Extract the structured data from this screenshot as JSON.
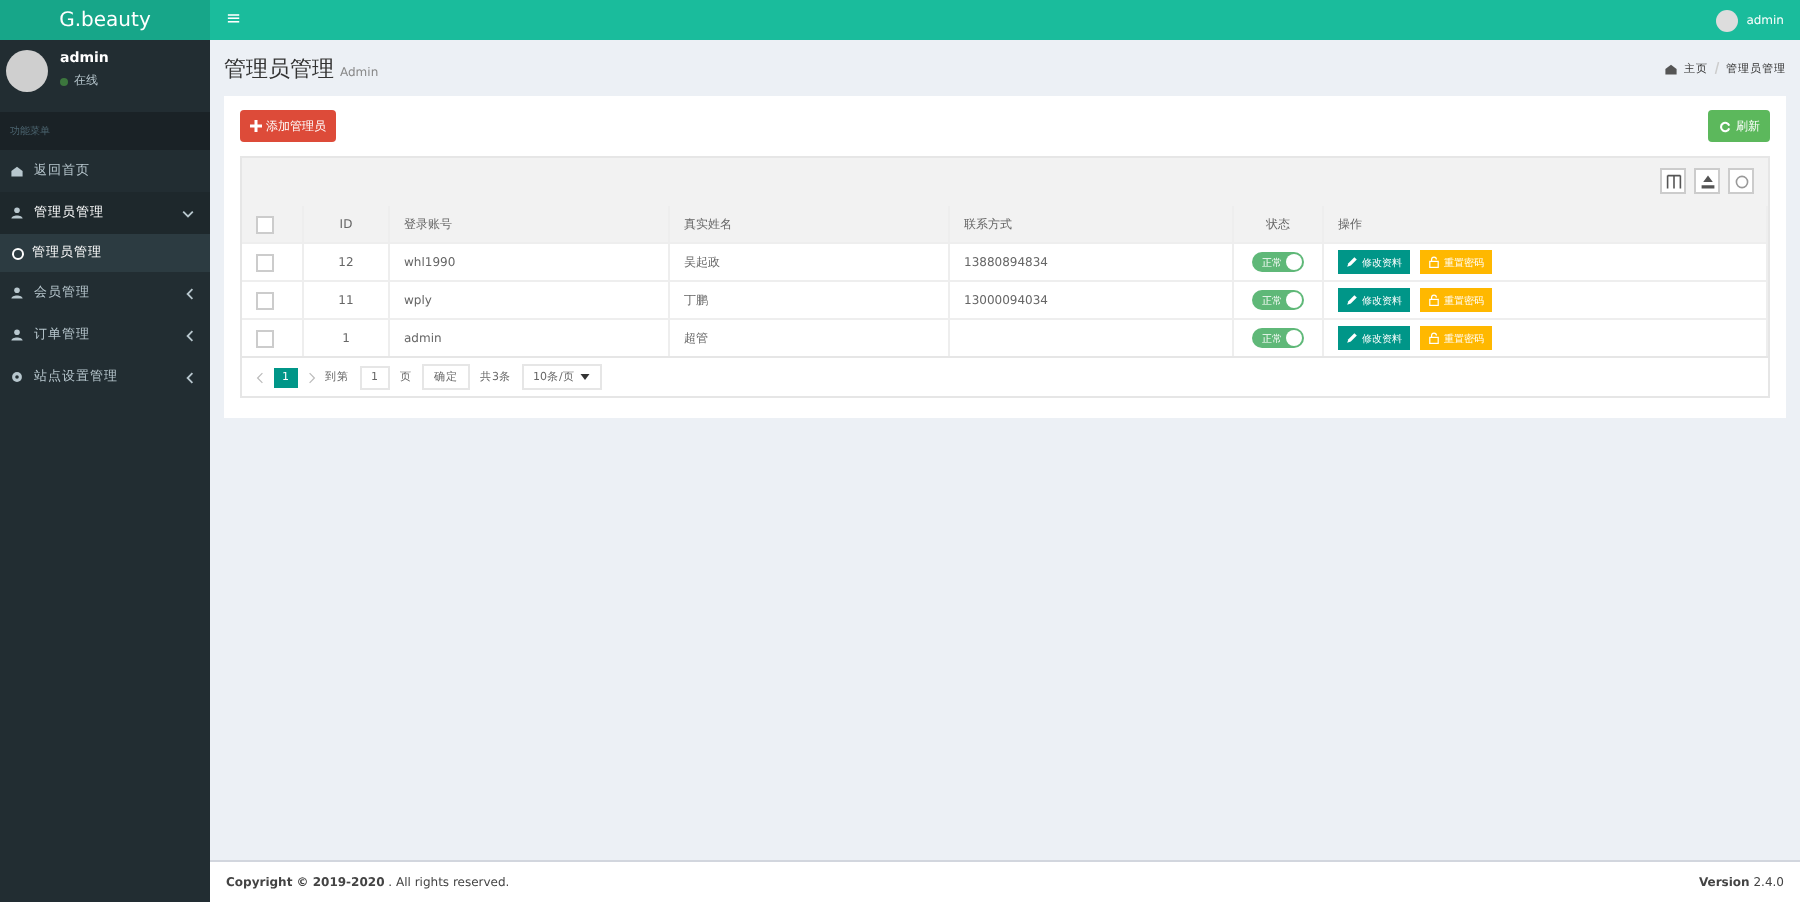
{
  "logo": "G.beauty",
  "user": {
    "name": "admin",
    "status": "在线"
  },
  "menu_header": "功能菜单",
  "menu": [
    {
      "label": "返回首页",
      "kind": "home",
      "selected": false
    },
    {
      "label": "管理员管理",
      "kind": "user",
      "expanded": true,
      "selected": false,
      "children": [
        {
          "label": "管理员管理",
          "selected": true
        }
      ]
    },
    {
      "label": "会员管理",
      "kind": "user",
      "expanded": false,
      "selected": false
    },
    {
      "label": "订单管理",
      "kind": "user",
      "expanded": false,
      "selected": false
    },
    {
      "label": "站点设置管理",
      "kind": "gear",
      "expanded": false,
      "selected": false
    }
  ],
  "topbar": {
    "menu_toggle": "≡",
    "user": "admin"
  },
  "page": {
    "title": "管理员管理",
    "subtitle": "Admin",
    "breadcrumb": [
      "主页",
      "管理员管理"
    ]
  },
  "toolbar": {
    "add_button": "添加管理员",
    "refresh_button": "刷新"
  },
  "table": {
    "all_checked": false,
    "columns": [
      "ID",
      "登录账号",
      "真实姓名",
      "联系方式",
      "状态",
      "操作"
    ],
    "rows": [
      {
        "checked": false,
        "id": "12",
        "account": "whl1990",
        "name": "吴起政",
        "phone": "13880894834",
        "status": "正常",
        "on": true,
        "actions": [
          "修改资料",
          "重置密码"
        ]
      },
      {
        "checked": false,
        "id": "11",
        "account": "wply",
        "name": "丁鹏",
        "phone": "13000094034",
        "status": "正常",
        "on": true,
        "actions": [
          "修改资料",
          "重置密码"
        ]
      },
      {
        "checked": false,
        "id": "1",
        "account": "admin",
        "name": "超管",
        "phone": "",
        "status": "正常",
        "on": true,
        "actions": [
          "修改资料",
          "重置密码"
        ]
      }
    ]
  },
  "pagination": {
    "pages": [
      {
        "label": "1",
        "selected": true
      }
    ],
    "goto_label": "到第",
    "page_value": "1",
    "page_unit": "页",
    "confirm": "确定",
    "total": "共3条",
    "page_size": "10条/页"
  },
  "footer": {
    "copyright": "Copyright © 2019-2020",
    "rights": ". All rights reserved.",
    "version_label": "Version",
    "version": "2.4.0"
  }
}
